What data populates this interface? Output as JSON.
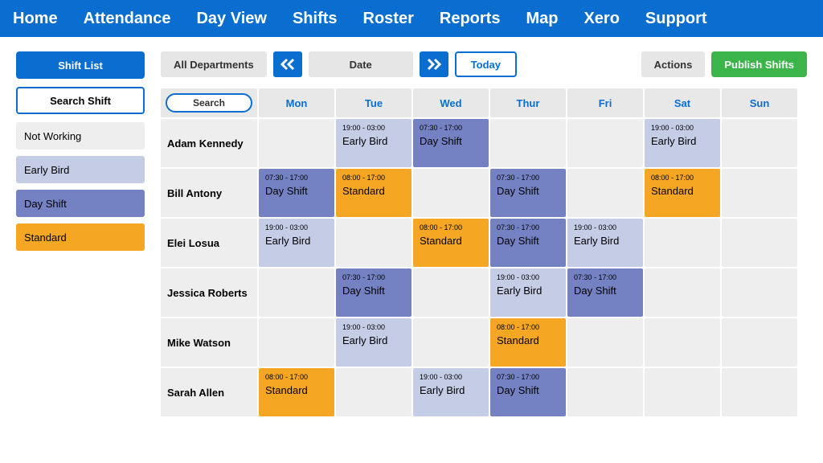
{
  "colors": {
    "not_working": "#eeeeee",
    "early_bird": "#c4cce6",
    "day_shift": "#7482c4",
    "standard": "#f5a623"
  },
  "nav": [
    "Home",
    "Attendance",
    "Day View",
    "Shifts",
    "Roster",
    "Reports",
    "Map",
    "Xero",
    "Support"
  ],
  "sidebar": {
    "shift_list": "Shift List",
    "search_shift": "Search Shift",
    "items": [
      {
        "label": "Not Working",
        "colorKey": "not_working"
      },
      {
        "label": "Early Bird",
        "colorKey": "early_bird"
      },
      {
        "label": "Day Shift",
        "colorKey": "day_shift"
      },
      {
        "label": "Standard",
        "colorKey": "standard"
      }
    ]
  },
  "toolbar": {
    "departments": "All Departments",
    "date": "Date",
    "today": "Today",
    "actions": "Actions",
    "publish": "Publish Shifts"
  },
  "grid": {
    "searchLabel": "Search",
    "days": [
      "Mon",
      "Tue",
      "Wed",
      "Thur",
      "Fri",
      "Sat",
      "Sun"
    ],
    "rows": [
      {
        "name": "Adam Kennedy",
        "cells": [
          null,
          {
            "time": "19:00 - 03:00",
            "type": "Early Bird",
            "colorKey": "early_bird"
          },
          {
            "time": "07:30 - 17:00",
            "type": "Day Shift",
            "colorKey": "day_shift"
          },
          null,
          null,
          {
            "time": "19:00 - 03:00",
            "type": "Early Bird",
            "colorKey": "early_bird"
          },
          null
        ]
      },
      {
        "name": "Bill Antony",
        "cells": [
          {
            "time": "07:30 - 17:00",
            "type": "Day Shift",
            "colorKey": "day_shift"
          },
          {
            "time": "08:00 - 17:00",
            "type": "Standard",
            "colorKey": "standard"
          },
          null,
          {
            "time": "07:30 - 17:00",
            "type": "Day Shift",
            "colorKey": "day_shift"
          },
          null,
          {
            "time": "08:00 - 17:00",
            "type": "Standard",
            "colorKey": "standard"
          },
          null
        ]
      },
      {
        "name": "Elei Losua",
        "cells": [
          {
            "time": "19:00 - 03:00",
            "type": "Early Bird",
            "colorKey": "early_bird"
          },
          null,
          {
            "time": "08:00 - 17:00",
            "type": "Standard",
            "colorKey": "standard"
          },
          {
            "time": "07:30 - 17:00",
            "type": "Day Shift",
            "colorKey": "day_shift"
          },
          {
            "time": "19:00 - 03:00",
            "type": "Early Bird",
            "colorKey": "early_bird"
          },
          null,
          null
        ]
      },
      {
        "name": "Jessica Roberts",
        "cells": [
          null,
          {
            "time": "07:30 - 17:00",
            "type": "Day Shift",
            "colorKey": "day_shift"
          },
          null,
          {
            "time": "19:00 - 03:00",
            "type": "Early Bird",
            "colorKey": "early_bird"
          },
          {
            "time": "07:30 - 17:00",
            "type": "Day Shift",
            "colorKey": "day_shift"
          },
          null,
          null
        ]
      },
      {
        "name": "Mike Watson",
        "cells": [
          null,
          {
            "time": "19:00 - 03:00",
            "type": "Early Bird",
            "colorKey": "early_bird"
          },
          null,
          {
            "time": "08:00 - 17:00",
            "type": "Standard",
            "colorKey": "standard"
          },
          null,
          null,
          null
        ]
      },
      {
        "name": "Sarah Allen",
        "cells": [
          {
            "time": "08:00 - 17:00",
            "type": "Standard",
            "colorKey": "standard"
          },
          null,
          {
            "time": "19:00 - 03:00",
            "type": "Early Bird",
            "colorKey": "early_bird"
          },
          {
            "time": "07:30 - 17:00",
            "type": "Day Shift",
            "colorKey": "day_shift"
          },
          null,
          null,
          null
        ]
      }
    ]
  }
}
